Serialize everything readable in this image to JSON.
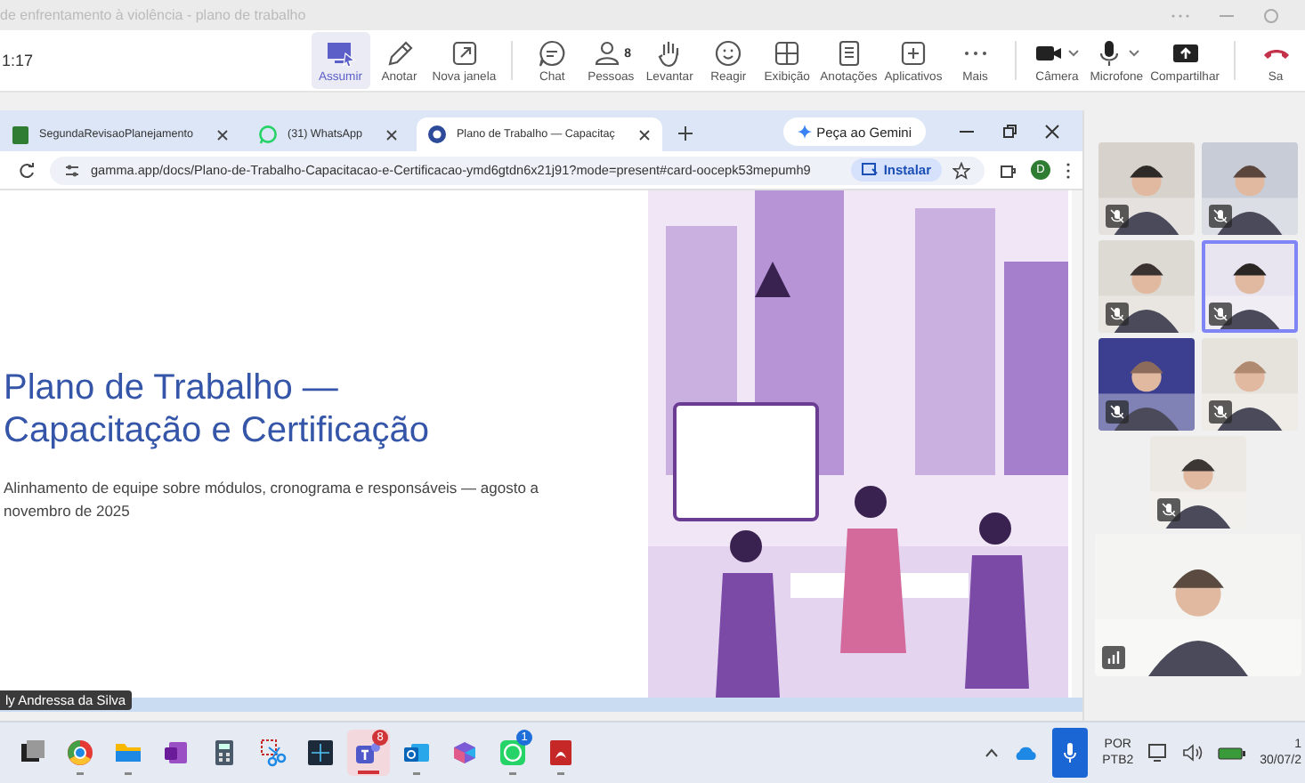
{
  "window": {
    "title": "de enfrentamento à violência - plano de trabalho"
  },
  "meeting": {
    "timer": "1:17",
    "actions": [
      {
        "label": "Assumir",
        "kind": "take",
        "selected": true
      },
      {
        "label": "Anotar",
        "kind": "pen",
        "selected": false
      },
      {
        "label": "Nova janela",
        "kind": "popout",
        "selected": false
      },
      {
        "label": "Chat",
        "kind": "chat",
        "selected": false,
        "group_start": true
      },
      {
        "label": "Pessoas",
        "kind": "people",
        "selected": false,
        "badge": "8"
      },
      {
        "label": "Levantar",
        "kind": "hand",
        "selected": false
      },
      {
        "label": "Reagir",
        "kind": "smiley",
        "selected": false
      },
      {
        "label": "Exibição",
        "kind": "grid",
        "selected": false
      },
      {
        "label": "Anotações",
        "kind": "notes",
        "selected": false
      },
      {
        "label": "Aplicativos",
        "kind": "apps",
        "selected": false
      },
      {
        "label": "Mais",
        "kind": "more",
        "selected": false
      },
      {
        "label": "Câmera",
        "kind": "camera",
        "selected": false,
        "group_start": true,
        "dropdown": true
      },
      {
        "label": "Microfone",
        "kind": "mic",
        "selected": false,
        "dropdown": true
      },
      {
        "label": "Compartilhar",
        "kind": "share",
        "selected": false
      },
      {
        "label": "Sa",
        "kind": "leave",
        "selected": false,
        "group_start": true
      }
    ]
  },
  "browser": {
    "tabs": [
      {
        "label": "SegundaRevisaoPlanejamento",
        "kind": "doc",
        "selected": false
      },
      {
        "label": "(31) WhatsApp",
        "kind": "whatsapp",
        "selected": false
      },
      {
        "label": "Plano de Trabalho — Capacitaç",
        "kind": "gamma",
        "selected": true
      }
    ],
    "gemini_button": "Peça ao Gemini",
    "url": "gamma.app/docs/Plano-de-Trabalho-Capacitacao-e-Certificacao-ymd6gtdn6x21j91?mode=present#card-oocepk53mepumh9",
    "install_button": "Instalar",
    "profile": "D"
  },
  "slide": {
    "title": "Plano de Trabalho — Capacitação e Certificação",
    "subtitle": "Alinhamento de equipe sobre módulos, cronograma e responsáveis — agosto a novembro de 2025",
    "illustration": {
      "kind": "picture"
    }
  },
  "presenter_label": "ly Andressa da Silva",
  "participants": [
    {
      "kind": "picture",
      "muted": true,
      "speaking": false
    },
    {
      "kind": "picture",
      "muted": true,
      "speaking": false
    },
    {
      "kind": "picture",
      "muted": true,
      "speaking": false
    },
    {
      "kind": "picture",
      "muted": true,
      "speaking": true
    },
    {
      "kind": "picture",
      "muted": true,
      "speaking": false
    },
    {
      "kind": "picture",
      "muted": true,
      "speaking": false
    },
    {
      "kind": "picture",
      "muted": true,
      "speaking": false
    },
    {
      "kind": "picture",
      "muted": false,
      "speaking": false
    }
  ],
  "taskbar": {
    "apps": [
      {
        "kind": "taskview",
        "running": false,
        "active": false
      },
      {
        "kind": "chrome",
        "running": true,
        "active": false
      },
      {
        "kind": "folder",
        "running": true,
        "active": false
      },
      {
        "kind": "onenote",
        "running": false,
        "active": false
      },
      {
        "kind": "calculator",
        "running": false,
        "active": false
      },
      {
        "kind": "snip",
        "running": false,
        "active": false
      },
      {
        "kind": "cx",
        "running": false,
        "active": false
      },
      {
        "kind": "teams",
        "running": true,
        "active": true,
        "badge": "8"
      },
      {
        "kind": "outlook",
        "running": true,
        "active": false
      },
      {
        "kind": "copilot",
        "running": false,
        "active": false
      },
      {
        "kind": "whatsapp",
        "running": true,
        "active": false,
        "badge": "1"
      },
      {
        "kind": "pdf",
        "running": true,
        "active": false
      }
    ],
    "language": "POR",
    "layout": "PTB2",
    "time": "1",
    "date": "30/07/2"
  }
}
